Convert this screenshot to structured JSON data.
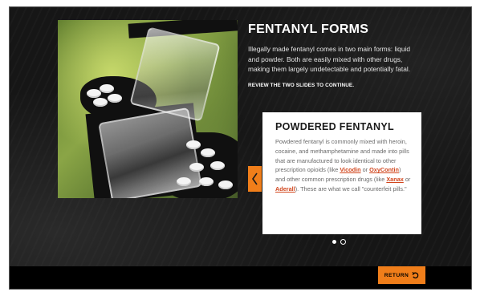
{
  "header": {
    "title": "FENTANYL FORMS",
    "intro": "Illegally made fentanyl comes in two main forms: liquid and powder. Both are easily mixed with other drugs, making them largely undetectable and potentially fatal.",
    "instruction": "REVIEW THE TWO SLIDES TO CONTINUE."
  },
  "card": {
    "title": "POWDERED FENTANYL",
    "text_1": "Powdered fentanyl is commonly mixed with heroin, cocaine, and methamphetamine and made into pills that are manufactured to look identical to other prescription opioids (like ",
    "link_vicodin": "Vicodin",
    "text_or_1": " or ",
    "link_oxycontin": "OxyContin",
    "text_2": ") and other common prescription drugs (like ",
    "link_xanax": "Xanax",
    "text_or_2": " or ",
    "link_aderall": "Aderall",
    "text_3": "). These are what we call \"counterfeit pills.\""
  },
  "carousel": {
    "prev_icon": "chevron-left-icon",
    "slide_count": 2,
    "active_slide": 1
  },
  "footer": {
    "return_label": "RETURN",
    "return_icon": "undo-arrow-icon"
  },
  "colors": {
    "accent": "#f07e1a",
    "link": "#d1461d",
    "background": "#161616",
    "card": "#ffffff"
  }
}
